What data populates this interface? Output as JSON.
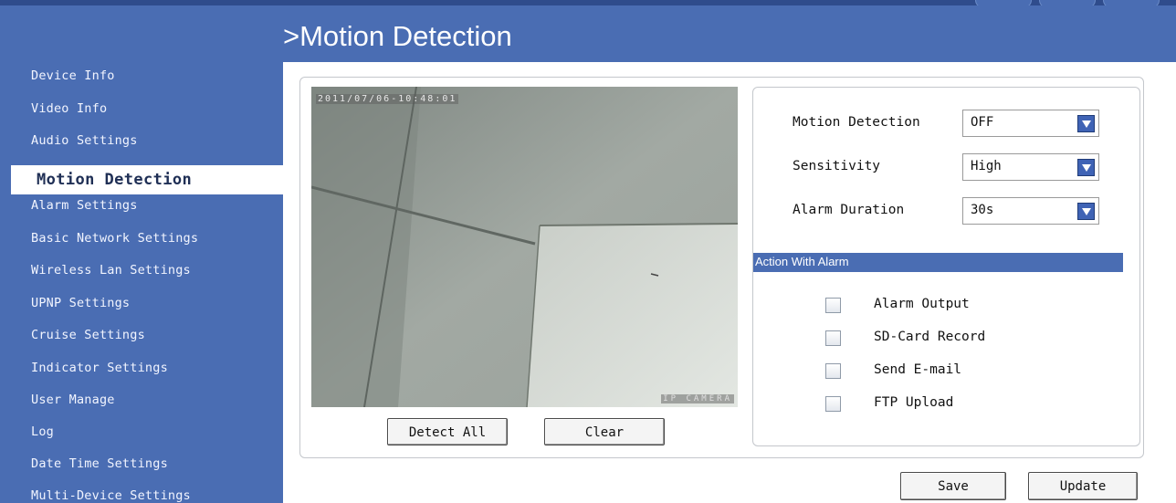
{
  "sidebar": {
    "items": [
      "Device Info",
      "Video Info",
      "Audio Settings",
      "Motion Detection",
      "Alarm Settings",
      "Basic Network Settings",
      "Wireless Lan Settings",
      "UPNP Settings",
      "Cruise Settings",
      "Indicator Settings",
      "User Manage",
      "Log",
      "Date Time Settings",
      "Multi-Device Settings"
    ],
    "active_label": "Motion Detection"
  },
  "header": {
    "title": ">Motion Detection"
  },
  "video": {
    "timestamp": "2011/07/06-10:48:01",
    "watermark": "IP CAMERA"
  },
  "buttons": {
    "detect_all": "Detect All",
    "clear": "Clear",
    "save": "Save",
    "update": "Update"
  },
  "settings": {
    "motion_detection": {
      "label": "Motion Detection",
      "value": "OFF"
    },
    "sensitivity": {
      "label": "Sensitivity",
      "value": "High"
    },
    "alarm_duration": {
      "label": "Alarm Duration",
      "value": "30s"
    }
  },
  "action_with_alarm": {
    "title": "Action With Alarm",
    "options": [
      {
        "label": "Alarm Output",
        "checked": false
      },
      {
        "label": "SD-Card Record",
        "checked": false
      },
      {
        "label": "Send E-mail",
        "checked": false
      },
      {
        "label": "FTP Upload",
        "checked": false
      }
    ]
  },
  "colors": {
    "nav_blue": "#4a6db3",
    "top_band": "#2f4c8c",
    "select_arrow": "#3f63b5"
  }
}
